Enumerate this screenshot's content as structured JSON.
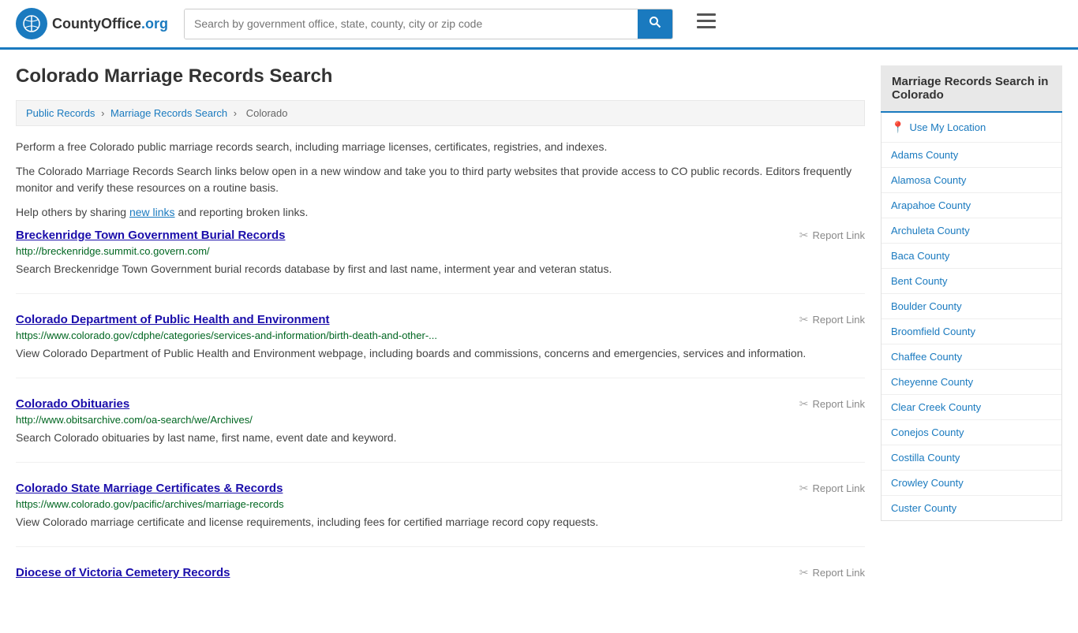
{
  "header": {
    "logo_text": "CountyOffice",
    "logo_suffix": ".org",
    "search_placeholder": "Search by government office, state, county, city or zip code",
    "search_button_label": "Search",
    "menu_label": "Menu"
  },
  "page": {
    "title": "Colorado Marriage Records Search",
    "breadcrumb": {
      "items": [
        {
          "label": "Public Records",
          "href": "#"
        },
        {
          "label": "Marriage Records Search",
          "href": "#"
        },
        {
          "label": "Colorado",
          "href": "#"
        }
      ]
    },
    "intro": {
      "paragraph1": "Perform a free Colorado public marriage records search, including marriage licenses, certificates, registries, and indexes.",
      "paragraph2": "The Colorado Marriage Records Search links below open in a new window and take you to third party websites that provide access to CO public records. Editors frequently monitor and verify these resources on a routine basis.",
      "paragraph3_prefix": "Help others by sharing ",
      "paragraph3_link": "new links",
      "paragraph3_suffix": " and reporting broken links."
    }
  },
  "records": [
    {
      "title": "Breckenridge Town Government Burial Records",
      "url": "http://breckenridge.summit.co.govern.com/",
      "description": "Search Breckenridge Town Government burial records database by first and last name, interment year and veteran status.",
      "report_label": "Report Link"
    },
    {
      "title": "Colorado Department of Public Health and Environment",
      "url": "https://www.colorado.gov/cdphe/categories/services-and-information/birth-death-and-other-...",
      "description": "View Colorado Department of Public Health and Environment webpage, including boards and commissions, concerns and emergencies, services and information.",
      "report_label": "Report Link"
    },
    {
      "title": "Colorado Obituaries",
      "url": "http://www.obitsarchive.com/oa-search/we/Archives/",
      "description": "Search Colorado obituaries by last name, first name, event date and keyword.",
      "report_label": "Report Link"
    },
    {
      "title": "Colorado State Marriage Certificates & Records",
      "url": "https://www.colorado.gov/pacific/archives/marriage-records",
      "description": "View Colorado marriage certificate and license requirements, including fees for certified marriage record copy requests.",
      "report_label": "Report Link"
    },
    {
      "title": "Diocese of Victoria Cemetery Records",
      "url": "",
      "description": "",
      "report_label": "Report Link"
    }
  ],
  "sidebar": {
    "title": "Marriage Records Search in Colorado",
    "use_location_label": "Use My Location",
    "counties": [
      "Adams County",
      "Alamosa County",
      "Arapahoe County",
      "Archuleta County",
      "Baca County",
      "Bent County",
      "Boulder County",
      "Broomfield County",
      "Chaffee County",
      "Cheyenne County",
      "Clear Creek County",
      "Conejos County",
      "Costilla County",
      "Crowley County",
      "Custer County"
    ]
  }
}
